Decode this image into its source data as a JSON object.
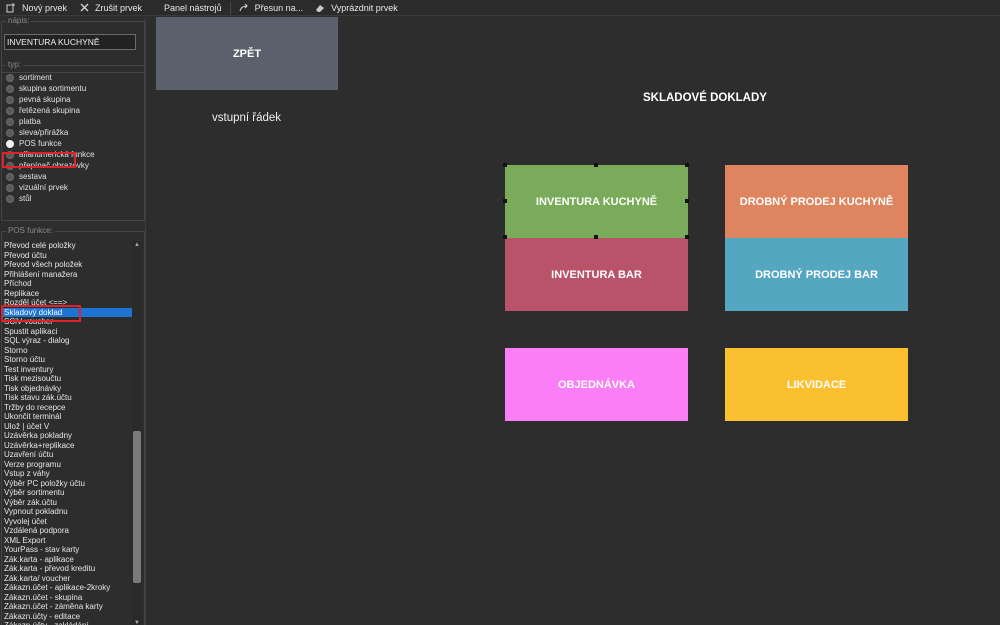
{
  "toolbar": {
    "new_item": "Nový prvek",
    "cancel_item": "Zrušit prvek",
    "tool_panel": "Panel nástrojů",
    "move_to": "Přesun na...",
    "empty_item": "Vyprázdnit prvek"
  },
  "left": {
    "napis_title": "nápis:",
    "napis_value": "INVENTURA KUCHYNĚ",
    "typ_title": "typ:",
    "types": [
      "sortiment",
      "skupina sortimentu",
      "pevná skupina",
      "řetězená skupina",
      "platba",
      "sleva/přirážka",
      "POS funkce",
      "alfanumerická funkce",
      "přepínač obrazovky",
      "sestava",
      "vizuální prvek",
      "stůl"
    ],
    "selected_type_index": 6,
    "posf_title": "POS funkce:",
    "functions": [
      "Převod celé položky",
      "Převod účtu",
      "Převod všech položek",
      "Přihlášení manažera",
      "Příchod",
      "Replikace",
      "Rozděl účet <==>",
      "Skladový doklad",
      "SCiV voucher",
      "Spustit aplikaci",
      "SQL výraz - dialog",
      "Storno",
      "Storno účtu",
      "Test inventury",
      "Tisk mezisoučtu",
      "Tisk objednávky",
      "Tisk stavu zák.účtu",
      "Tržby do recepce",
      "Ukončit terminál",
      "Ulož | účet V",
      "Uzávěrka pokladny",
      "Uzávěrka+replikace",
      "Uzavření účtu",
      "Verze programu",
      "Vstup z váhy",
      "Výběr PC položky účtu",
      "Výběr sortimentu",
      "Výběr zák.účtu",
      "Vypnout pokladnu",
      "Vyvolej účet",
      "Vzdálená podpora",
      "XML Export",
      "YourPass - stav karty",
      "Zák.karta - aplikace",
      "Zák.karta - převod kreditu",
      "Zák.karta/ voucher",
      "Zákazn.účet - aplikace-2kroky",
      "Zákazn.účet - skupina",
      "Zákazn.účet - záměna karty",
      "Zákazn.účty - editace",
      "Zákazn.účty - zakládání"
    ],
    "selected_function_index": 7
  },
  "canvas": {
    "back": "ZPĚT",
    "input_row": "vstupní řádek",
    "title": "SKLADOVÉ DOKLADY",
    "tiles": [
      {
        "label": "INVENTURA KUCHYNĚ",
        "color": "#7aab5b"
      },
      {
        "label": "DROBNÝ PRODEJ KUCHYNĚ",
        "color": "#de8560"
      },
      {
        "label": "INVENTURA BAR",
        "color": "#b9536a"
      },
      {
        "label": "DROBNÝ PRODEJ BAR",
        "color": "#55a7c1"
      },
      {
        "label": "OBJEDNÁVKA",
        "color": "#fa7ef5"
      },
      {
        "label": "LIKVIDACE",
        "color": "#fbc02f"
      }
    ]
  },
  "colors": {
    "background": "#2d2d2d",
    "selection": "#1e74d2",
    "highlight": "#e0222d",
    "back_button": "#5a616d"
  }
}
